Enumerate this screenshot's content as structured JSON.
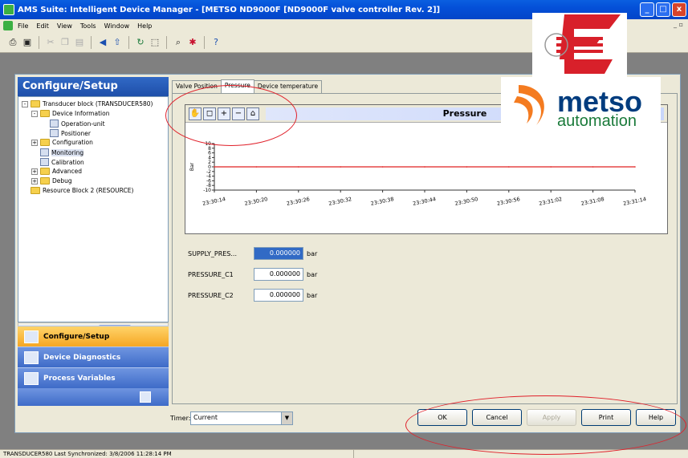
{
  "window": {
    "title": "AMS Suite: Intelligent Device Manager - [METSO ND9000F [ND9000F valve controller Rev. 2]]",
    "controls": {
      "minimize": "_",
      "maximize": "□",
      "close": "x"
    },
    "mdi_controls": "_ ▫"
  },
  "menu": [
    "File",
    "Edit",
    "View",
    "Tools",
    "Window",
    "Help"
  ],
  "left_pane": {
    "header": "Configure/Setup",
    "tree": [
      {
        "label": "Transducer block (TRANSDUCER580)",
        "level": 0,
        "type": "folder",
        "expander": "-"
      },
      {
        "label": "Device Information",
        "level": 1,
        "type": "folder",
        "expander": "-"
      },
      {
        "label": "Operation-unit",
        "level": 2,
        "type": "param",
        "expander": ""
      },
      {
        "label": "Positioner",
        "level": 2,
        "type": "param",
        "expander": ""
      },
      {
        "label": "Configuration",
        "level": 1,
        "type": "folder",
        "expander": "+"
      },
      {
        "label": "Monitoring",
        "level": 1,
        "type": "param",
        "expander": "",
        "selected": true
      },
      {
        "label": "Calibration",
        "level": 1,
        "type": "param",
        "expander": ""
      },
      {
        "label": "Advanced",
        "level": 1,
        "type": "folder",
        "expander": "+"
      },
      {
        "label": "Debug",
        "level": 1,
        "type": "folder",
        "expander": "+"
      },
      {
        "label": "Resource Block 2 (RESOURCE)",
        "level": 0,
        "type": "folder",
        "expander": ""
      }
    ],
    "nav": {
      "configure": "Configure/Setup",
      "diagnostics": "Device Diagnostics",
      "process": "Process Variables"
    }
  },
  "tabs": [
    "Valve Position",
    "Pressure",
    "Device temperature"
  ],
  "chart": {
    "title": "Pressure",
    "ylabel": "Bar"
  },
  "chart_data": {
    "type": "line",
    "title": "Pressure",
    "ylabel": "Bar",
    "ylim": [
      -10,
      10
    ],
    "y_ticks": [
      10,
      8,
      6,
      4,
      2,
      0,
      -2,
      -4,
      -6,
      -8,
      -10
    ],
    "x_ticks": [
      "23:30:14",
      "23:30:20",
      "23:30:26",
      "23:30:32",
      "23:30:38",
      "23:30:44",
      "23:30:50",
      "23:30:56",
      "23:31:02",
      "23:31:08",
      "23:31:14"
    ],
    "series": [
      {
        "values": [
          0,
          0,
          0,
          0,
          0,
          0,
          0,
          0,
          0,
          0,
          0
        ],
        "color": "#e02020"
      }
    ]
  },
  "fields": [
    {
      "label": "SUPPLY_PRES...",
      "value": "0.000000",
      "unit": "bar",
      "selected": true
    },
    {
      "label": "PRESSURE_C1",
      "value": "0.000000",
      "unit": "bar",
      "selected": false
    },
    {
      "label": "PRESSURE_C2",
      "value": "0.000000",
      "unit": "bar",
      "selected": false
    }
  ],
  "timer": {
    "label": "Timer:",
    "value": "Current"
  },
  "buttons": {
    "ok": "OK",
    "cancel": "Cancel",
    "apply": "Apply",
    "print": "Print",
    "help": "Help"
  },
  "status": "TRANSDUCER580 Last Synchronized: 3/8/2006 11:28:14 PM",
  "logo": {
    "word1": "metso",
    "word2": "automation"
  },
  "colors": {
    "accent": "#0a5fe0",
    "annotation": "#e0202a",
    "series": "#e02020",
    "nav_active": "#f5a623"
  }
}
